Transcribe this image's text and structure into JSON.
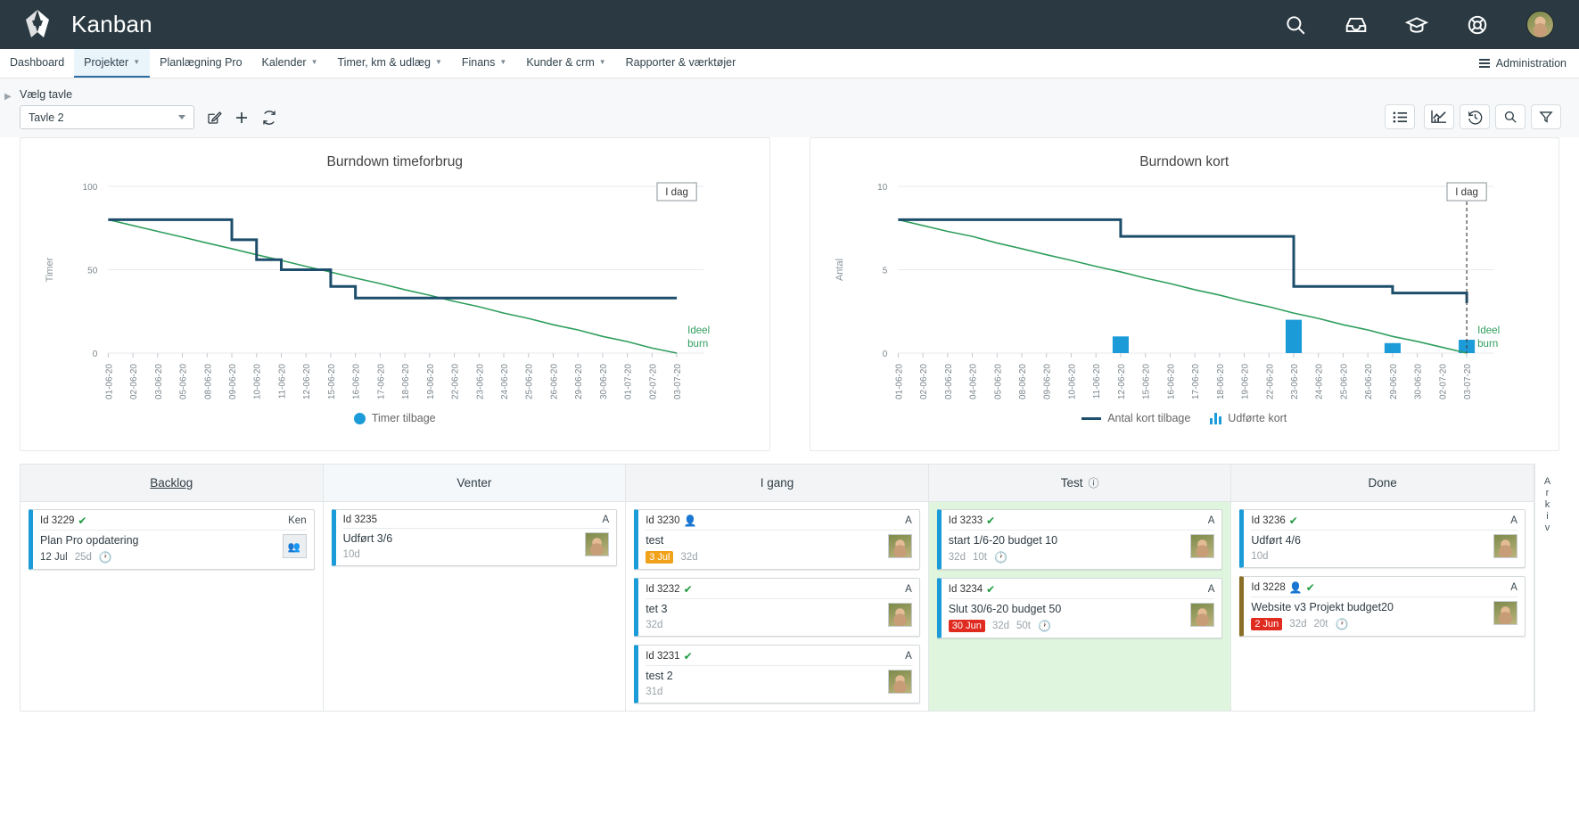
{
  "header": {
    "app_title": "Kanban",
    "logo_icon": "kanban-logo-icon",
    "icons": [
      {
        "name": "search-icon",
        "label": "Søg"
      },
      {
        "name": "inbox-icon",
        "label": "Indbakke"
      },
      {
        "name": "graduation-cap-icon",
        "label": "Læring"
      },
      {
        "name": "life-ring-icon",
        "label": "Support"
      }
    ],
    "avatar": "user-avatar"
  },
  "nav": {
    "items": [
      {
        "label": "Dashboard",
        "caret": false,
        "active": false
      },
      {
        "label": "Projekter",
        "caret": true,
        "active": true
      },
      {
        "label": "Planlægning Pro",
        "caret": false,
        "active": false
      },
      {
        "label": "Kalender",
        "caret": true,
        "active": false
      },
      {
        "label": "Timer, km & udlæg",
        "caret": true,
        "active": false
      },
      {
        "label": "Finans",
        "caret": true,
        "active": false
      },
      {
        "label": "Kunder & crm",
        "caret": true,
        "active": false
      },
      {
        "label": "Rapporter & værktøjer",
        "caret": false,
        "active": false
      }
    ],
    "admin_label": "Administration"
  },
  "toolbar": {
    "board_label": "Vælg tavle",
    "board_value": "Tavle 2",
    "edit_icon": "edit-board-icon",
    "add_icon": "add-board-icon",
    "refresh_icon": "refresh-board-icon",
    "right_icons": [
      {
        "name": "list-view-icon"
      },
      {
        "name": "chart-view-icon"
      },
      {
        "name": "history-icon"
      },
      {
        "name": "search-icon"
      },
      {
        "name": "filter-icon"
      }
    ]
  },
  "chart_data": [
    {
      "type": "line",
      "title": "Burndown timeforbrug",
      "xlabel": "",
      "ylabel": "Timer",
      "ylim": [
        0,
        100
      ],
      "yticks": [
        0,
        50,
        100
      ],
      "grid": true,
      "legend_position": "bottom",
      "annotation": "I dag",
      "ideal_label": "Ideel burn",
      "categories": [
        "01-06-20",
        "02-06-20",
        "03-06-20",
        "05-06-20",
        "08-06-20",
        "09-06-20",
        "10-06-20",
        "11-06-20",
        "12-06-20",
        "15-06-20",
        "16-06-20",
        "17-06-20",
        "18-06-20",
        "19-06-20",
        "22-06-20",
        "23-06-20",
        "24-06-20",
        "25-06-20",
        "26-06-20",
        "29-06-20",
        "30-06-20",
        "01-07-20",
        "02-07-20",
        "03-07-20"
      ],
      "series": [
        {
          "name": "Timer tilbage",
          "color": "#1d4e6b",
          "values": [
            80,
            80,
            80,
            80,
            80,
            68,
            56,
            50,
            50,
            40,
            33,
            33,
            33,
            33,
            33,
            33,
            33,
            33,
            33,
            33,
            33,
            33,
            33,
            33
          ]
        },
        {
          "name": "Ideel burn",
          "color": "#2f9e5e",
          "values": [
            80,
            76.5,
            73,
            69.6,
            66,
            62.6,
            59,
            55.6,
            52,
            48.6,
            45,
            41.7,
            38,
            34.7,
            31,
            27.8,
            24,
            20.8,
            17,
            13.9,
            10,
            6.9,
            3,
            0
          ]
        }
      ]
    },
    {
      "type": "line",
      "title": "Burndown kort",
      "xlabel": "",
      "ylabel": "Antal",
      "ylim": [
        0,
        10
      ],
      "yticks": [
        0,
        5,
        10
      ],
      "grid": true,
      "legend_position": "bottom",
      "annotation": "I dag",
      "ideal_label": "Ideel burn",
      "categories": [
        "01-06-20",
        "02-06-20",
        "03-06-20",
        "04-06-20",
        "05-06-20",
        "08-06-20",
        "09-06-20",
        "10-06-20",
        "11-06-20",
        "12-06-20",
        "15-06-20",
        "16-06-20",
        "17-06-20",
        "18-06-20",
        "19-06-20",
        "22-06-20",
        "23-06-20",
        "24-06-20",
        "25-06-20",
        "26-06-20",
        "29-06-20",
        "30-06-20",
        "02-07-20",
        "03-07-20"
      ],
      "series": [
        {
          "name": "Antal kort tilbage",
          "color": "#1d4e6b",
          "values": [
            8,
            8,
            8,
            8,
            8,
            8,
            8,
            8,
            8,
            7,
            7,
            7,
            7,
            7,
            7,
            7,
            4,
            4,
            4,
            4,
            3.6,
            3.6,
            3.6,
            3
          ]
        },
        {
          "name": "Ideel burn",
          "color": "#2f9e5e",
          "values": [
            8,
            7.65,
            7.3,
            7,
            6.6,
            6.26,
            5.9,
            5.56,
            5.2,
            4.87,
            4.5,
            4.17,
            3.8,
            3.48,
            3.1,
            2.78,
            2.4,
            2.08,
            1.7,
            1.39,
            1.0,
            0.7,
            0.35,
            0
          ]
        },
        {
          "name": "Udførte kort",
          "color": "#1b9bd8",
          "type": "bar",
          "values": [
            0,
            0,
            0,
            0,
            0,
            0,
            0,
            0,
            0,
            1,
            0,
            0,
            0,
            0,
            0,
            0,
            2,
            0,
            0,
            0,
            0.6,
            0,
            0,
            0.8
          ]
        }
      ]
    }
  ],
  "board": {
    "archive_label": "Arkiv",
    "columns": [
      {
        "title": "Backlog",
        "underline": true,
        "info_icon": false,
        "tinted": false,
        "green": false,
        "cards": [
          {
            "id": "Id 3229",
            "check": true,
            "person": false,
            "owner": "Ken",
            "title": "Plan Pro opdatering",
            "badge": {
              "text": "12 Jul",
              "color": "none"
            },
            "days": "25d",
            "hours": "",
            "clock": true,
            "avatar": "placeholder",
            "accent": "#1b9bd8"
          }
        ]
      },
      {
        "title": "Venter",
        "underline": false,
        "info_icon": false,
        "tinted": true,
        "green": false,
        "cards": [
          {
            "id": "Id 3235",
            "check": false,
            "person": false,
            "owner": "A",
            "title": "Udført 3/6",
            "badge": null,
            "days": "10d",
            "hours": "",
            "clock": false,
            "avatar": "user",
            "accent": "#1b9bd8"
          }
        ]
      },
      {
        "title": "I gang",
        "underline": false,
        "info_icon": false,
        "tinted": false,
        "green": false,
        "cards": [
          {
            "id": "Id 3230",
            "check": false,
            "person": true,
            "owner": "A",
            "title": "test",
            "badge": {
              "text": "3 Jul",
              "color": "orange"
            },
            "days": "32d",
            "hours": "",
            "clock": false,
            "avatar": "user",
            "accent": "#1b9bd8"
          },
          {
            "id": "Id 3232",
            "check": true,
            "person": false,
            "owner": "A",
            "title": "tet 3",
            "badge": null,
            "days": "32d",
            "hours": "",
            "clock": false,
            "avatar": "user",
            "accent": "#1b9bd8"
          },
          {
            "id": "Id 3231",
            "check": true,
            "person": false,
            "owner": "A",
            "title": "test 2",
            "badge": null,
            "days": "31d",
            "hours": "",
            "clock": false,
            "avatar": "user",
            "accent": "#1b9bd8"
          }
        ]
      },
      {
        "title": "Test",
        "underline": false,
        "info_icon": true,
        "tinted": false,
        "green": true,
        "cards": [
          {
            "id": "Id 3233",
            "check": true,
            "person": false,
            "owner": "A",
            "title": "start 1/6-20 budget 10",
            "badge": null,
            "days": "32d",
            "hours": "10t",
            "clock": true,
            "avatar": "user",
            "accent": "#1b9bd8"
          },
          {
            "id": "Id 3234",
            "check": true,
            "person": false,
            "owner": "A",
            "title": "Slut 30/6-20 budget 50",
            "badge": {
              "text": "30 Jun",
              "color": "red"
            },
            "days": "32d",
            "hours": "50t",
            "clock": true,
            "avatar": "user",
            "accent": "#1b9bd8"
          }
        ]
      },
      {
        "title": "Done",
        "underline": false,
        "info_icon": false,
        "tinted": false,
        "green": false,
        "cards": [
          {
            "id": "Id 3236",
            "check": true,
            "person": false,
            "owner": "A",
            "title": "Udført 4/6",
            "badge": null,
            "days": "10d",
            "hours": "",
            "clock": false,
            "avatar": "user",
            "accent": "#1b9bd8"
          },
          {
            "id": "Id 3228",
            "check": true,
            "person": true,
            "owner": "A",
            "title": "Website v3 Projekt budget20",
            "badge": {
              "text": "2 Jun",
              "color": "red"
            },
            "days": "32d",
            "hours": "20t",
            "clock": true,
            "avatar": "user",
            "accent": "#8a6d27"
          }
        ]
      }
    ]
  }
}
